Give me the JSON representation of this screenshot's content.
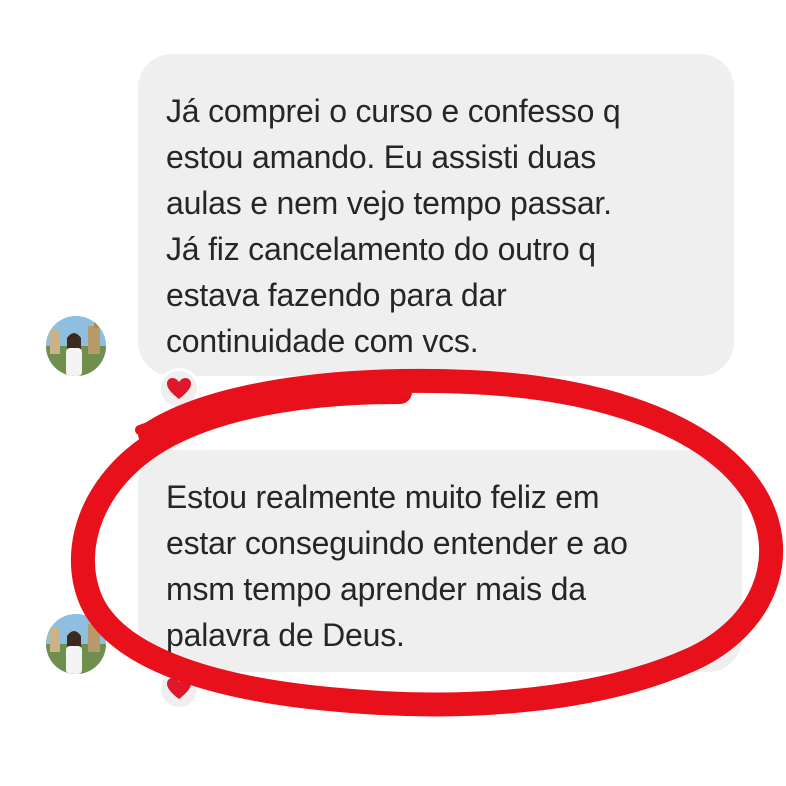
{
  "messages": [
    {
      "lines": [
        "Já comprei o curso e confesso q",
        "estou amando. Eu assisti duas",
        "aulas e nem vejo tempo passar.",
        "Já fiz cancelamento do outro q",
        "estava fazendo para dar",
        "continuidade com vcs."
      ],
      "reaction": "heart-icon"
    },
    {
      "lines": [
        "Estou realmente muito feliz em",
        "estar conseguindo entender e ao",
        "msm tempo aprender mais da",
        "palavra de Deus."
      ],
      "reaction": "heart-icon"
    }
  ],
  "colors": {
    "bubble": "#efefef",
    "text": "#262626",
    "highlight": "#e8101a",
    "heart": "#e0162b"
  }
}
